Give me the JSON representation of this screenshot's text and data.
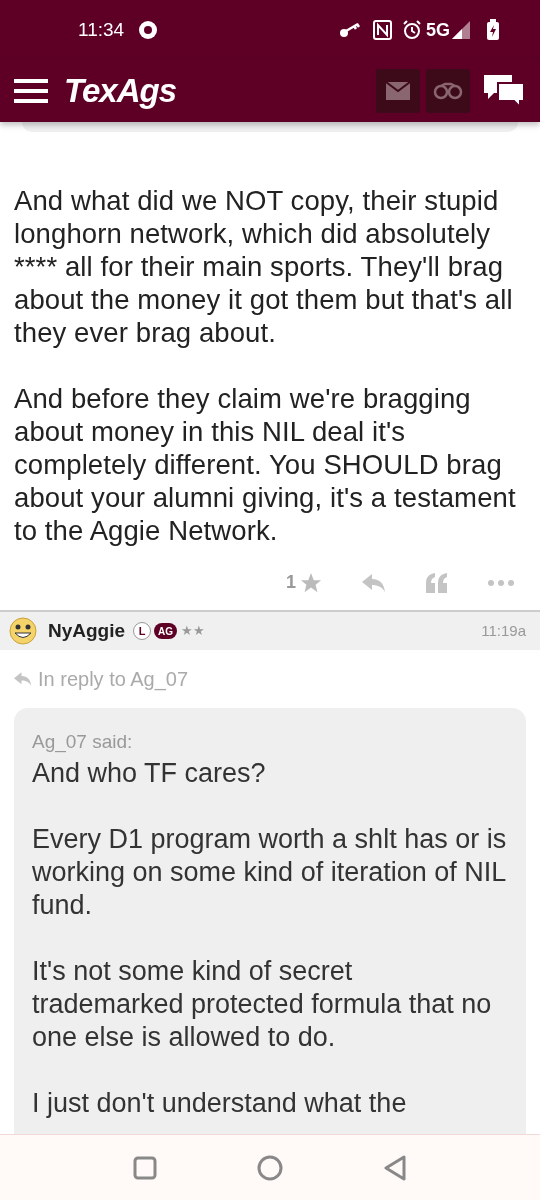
{
  "status_bar": {
    "time": "11:34",
    "network": "5G"
  },
  "header": {
    "logo": "TexAgs"
  },
  "post": {
    "paragraphs": [
      "And what did we NOT copy, their stupid longhorn network, which did absolutely **** all for their main sports. They'll brag about the money it got them but that's all they ever brag about.",
      "And before they claim we're bragging about money in this NIL deal it's completely different. You SHOULD brag about your alumni giving, it's a testament to the Aggie Network."
    ],
    "star_count": "1"
  },
  "reply": {
    "username": "NyAggie",
    "badges": [
      "L",
      "AG"
    ],
    "rank_stars": "★★",
    "time": "11:19a",
    "in_reply_to": "In reply to Ag_07",
    "quote": {
      "author": "Ag_07 said:",
      "paragraphs": [
        "And who TF cares?",
        "Every D1 program worth a shlt has or is working on some kind of iteration of NIL fund.",
        "It's not some kind of secret trademarked protected formula that no one else is allowed to do.",
        "I just don't understand what the"
      ]
    }
  }
}
